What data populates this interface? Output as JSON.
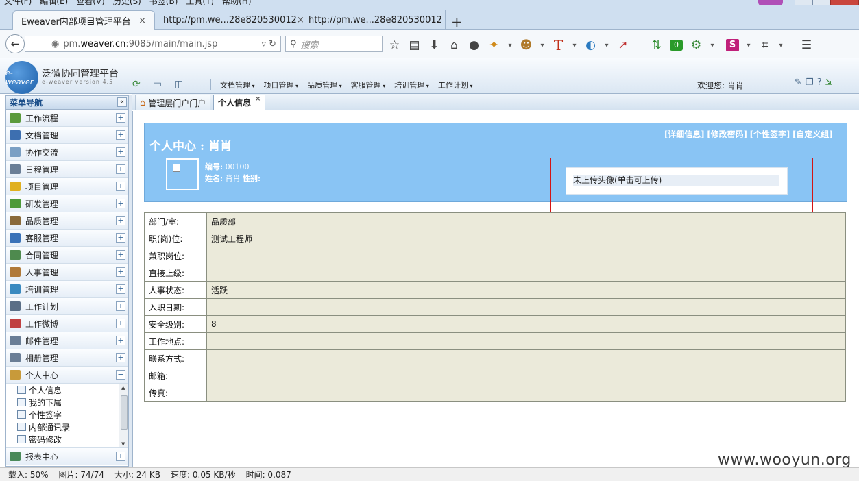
{
  "browser": {
    "menubar": [
      "文件(F)",
      "编辑(E)",
      "查看(V)",
      "历史(S)",
      "书签(B)",
      "工具(T)",
      "帮助(H)"
    ],
    "tabs": [
      {
        "title": "Eweaver内部项目管理平台",
        "close": "×"
      },
      {
        "title": "http://pm.we...28e820530012",
        "close": "×"
      },
      {
        "title": "http://pm.we...28e820530012"
      }
    ],
    "new_tab": "+",
    "url_prefix": "pm.",
    "url_host": "weaver.cn",
    "url_rest": ":9085/main/main.jsp",
    "search_placeholder": "搜索",
    "badge_count": "0"
  },
  "app": {
    "logo_text": "e-weaver",
    "title": "泛微协同管理平台",
    "subtitle": "e-weaver version 4.5",
    "top_menu": [
      "文档管理",
      "项目管理",
      "品质管理",
      "客服管理",
      "培训管理",
      "工作计划"
    ],
    "welcome": "欢迎您: 肖肖"
  },
  "sidebar": {
    "title": "菜单导航",
    "collapse": "«",
    "items": [
      {
        "label": "工作流程",
        "color": "#5a9a3c"
      },
      {
        "label": "文档管理",
        "color": "#3d6fb0"
      },
      {
        "label": "协作交流",
        "color": "#7a9fc4"
      },
      {
        "label": "日程管理",
        "color": "#6a7e96"
      },
      {
        "label": "项目管理",
        "color": "#e0b020"
      },
      {
        "label": "研发管理",
        "color": "#4d9a3a"
      },
      {
        "label": "品质管理",
        "color": "#8a6a3a"
      },
      {
        "label": "客服管理",
        "color": "#3a72b8"
      },
      {
        "label": "合同管理",
        "color": "#4e8a4e"
      },
      {
        "label": "人事管理",
        "color": "#b07a3a"
      },
      {
        "label": "培训管理",
        "color": "#3a8ac0"
      },
      {
        "label": "工作计划",
        "color": "#5a6e86"
      },
      {
        "label": "工作微博",
        "color": "#c04040"
      },
      {
        "label": "邮件管理",
        "color": "#6a7e96"
      },
      {
        "label": "相册管理",
        "color": "#6a7e96"
      }
    ],
    "expanded": {
      "label": "个人中心",
      "color": "#c89a3a",
      "toggle": "−"
    },
    "sub_items": [
      "个人信息",
      "我的下属",
      "个性签字",
      "内部通讯录",
      "密码修改"
    ],
    "last": {
      "label": "报表中心",
      "color": "#4a8a5a"
    },
    "plus": "+"
  },
  "content_tabs": [
    {
      "label": "管理层门户门户"
    },
    {
      "label": "个人信息",
      "close": "×"
    }
  ],
  "profile": {
    "title": "个人中心 : 肖肖",
    "links": [
      "[详细信息]",
      "[修改密码]",
      "[个性签字]",
      "[自定义组]"
    ],
    "id_label": "编号:",
    "id_value": "00100",
    "name_label": "姓名:",
    "name_value": "肖肖",
    "gender_label": "性别:",
    "upload_text": "未上传头像(单击可上传)"
  },
  "info_rows": [
    {
      "label": "部门/室:",
      "value": "品质部"
    },
    {
      "label": "职(岗)位:",
      "value": "测试工程师"
    },
    {
      "label": "兼职岗位:",
      "value": ""
    },
    {
      "label": "直接上级:",
      "value": ""
    },
    {
      "label": "人事状态:",
      "value": "活跃"
    },
    {
      "label": "入职日期:",
      "value": ""
    },
    {
      "label": "安全级别:",
      "value": "8"
    },
    {
      "label": "工作地点:",
      "value": ""
    },
    {
      "label": "联系方式:",
      "value": ""
    },
    {
      "label": "邮箱:",
      "value": ""
    },
    {
      "label": "传真:",
      "value": ""
    }
  ],
  "watermark": "www.wooyun.org",
  "status": {
    "load": "载入: 50%",
    "images": "图片: 74/74",
    "size": "大小: 24 KB",
    "speed": "速度: 0.05 KB/秒",
    "time": "时间: 0.087"
  }
}
